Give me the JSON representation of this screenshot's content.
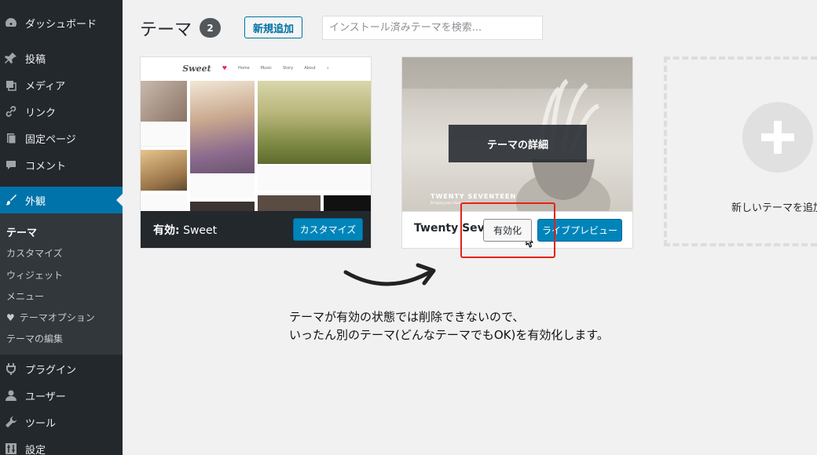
{
  "sidebar": {
    "items": [
      {
        "label": "ダッシュボード",
        "icon": "dashboard-icon"
      },
      {
        "label": "投稿",
        "icon": "pin-icon"
      },
      {
        "label": "メディア",
        "icon": "media-icon"
      },
      {
        "label": "リンク",
        "icon": "link-icon"
      },
      {
        "label": "固定ページ",
        "icon": "page-icon"
      },
      {
        "label": "コメント",
        "icon": "comment-icon"
      },
      {
        "label": "外観",
        "icon": "appearance-brush-icon"
      },
      {
        "label": "プラグイン",
        "icon": "plugin-icon"
      },
      {
        "label": "ユーザー",
        "icon": "user-icon"
      },
      {
        "label": "ツール",
        "icon": "wrench-icon"
      },
      {
        "label": "設定",
        "icon": "settings-icon"
      }
    ],
    "submenu": [
      {
        "label": "テーマ"
      },
      {
        "label": "カスタマイズ"
      },
      {
        "label": "ウィジェット"
      },
      {
        "label": "メニュー"
      },
      {
        "label": "テーマオプション",
        "icon": "heart-icon"
      },
      {
        "label": "テーマの編集"
      }
    ]
  },
  "header": {
    "title": "テーマ",
    "count": "2",
    "add_new_label": "新規追加",
    "search_placeholder": "インストール済みテーマを検索..."
  },
  "themes": {
    "active": {
      "prefix": "有効:",
      "name": "Sweet",
      "customize_label": "カスタマイズ",
      "screenshot": {
        "logo": "Sweet",
        "nav": [
          "Home",
          "Music",
          "Story",
          "About"
        ]
      }
    },
    "inactive": {
      "name": "Twenty Seventeen",
      "overlay_label": "テーマの詳細",
      "activate_label": "有効化",
      "preview_label": "ライブプレビュー",
      "image_title": "TWENTY SEVENTEEN",
      "image_subtitle": "Bringing your ideas to life"
    }
  },
  "add_theme": {
    "label": "新しいテーマを追加"
  },
  "annotation": {
    "line1": "テーマが有効の状態では削除できないので、",
    "line2": "いったん別のテーマ(どんなテーマでもOK)を有効化します。"
  },
  "colors": {
    "sidebar_bg": "#23282d",
    "accent": "#0073aa",
    "highlight_red": "#e2231a"
  }
}
